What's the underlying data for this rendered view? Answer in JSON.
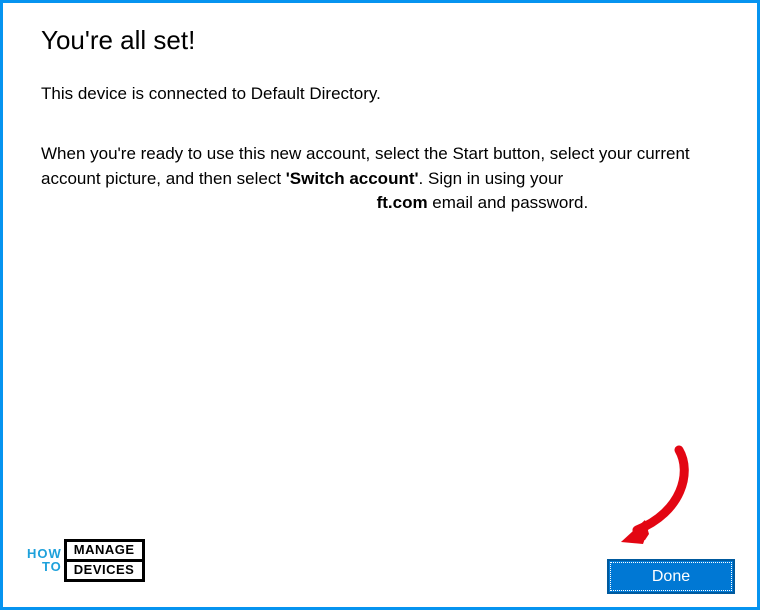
{
  "title": "You're all set!",
  "subtitle": "This device is connected to Default Directory.",
  "instruction": {
    "prefix": "When you're ready to use this new account, select the Start button, select your current account picture, and then select ",
    "bold": "'Switch account'",
    "middle": ". Sign in using your",
    "email_obscured_prefix": "",
    "email_suffix": "ft.com",
    "suffix": " email and password."
  },
  "logo": {
    "word1": "HOW",
    "word2": "TO",
    "box1": "MANAGE",
    "box2": "DEVICES"
  },
  "done_button": "Done"
}
